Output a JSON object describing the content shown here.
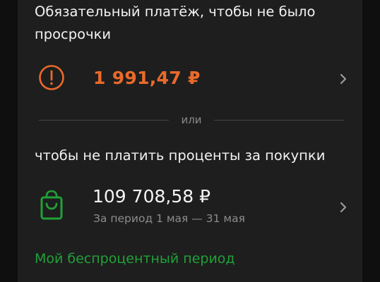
{
  "mandatory": {
    "heading": "Обязательный платёж, чтобы не было\nпросрочки",
    "amount": "1 991,47 ₽",
    "icon": "exclamation-circle-icon",
    "accent_color": "#ea6a2a"
  },
  "divider": {
    "label": "или"
  },
  "full": {
    "heading": "чтобы не платить проценты за покупки",
    "amount": "109 708,58 ₽",
    "period": "За период 1 мая — 31 мая",
    "icon": "shopping-bag-icon",
    "accent_color": "#21a038"
  },
  "footer": {
    "link_label": "Мой беспроцентный период",
    "link_color": "#21a038"
  }
}
